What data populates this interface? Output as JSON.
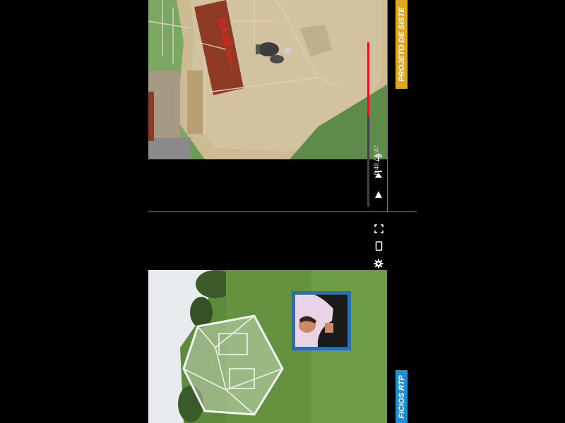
{
  "player": {
    "time_current": "0:48",
    "time_total": "1:47",
    "time_display": "0:48 / 1:47",
    "progress_fraction": 0.448
  },
  "banners": {
    "top_text": "PROJETO DE SISTE",
    "bottom_text": "FICIOS RTP"
  },
  "scene": {
    "sign_text": "BASE DADOS"
  },
  "icons": {
    "play": "play-icon",
    "skip": "skip-next-icon",
    "broadcast": "broadcast-icon",
    "fullscreen": "fullscreen-icon",
    "mobile": "mobile-icon",
    "settings": "gear-icon"
  },
  "colors": {
    "progress": "#e3171e",
    "banner_top": "#e0a91d",
    "banner_bottom": "#1c8fd6",
    "frame_blue": "#2a6fb5"
  }
}
